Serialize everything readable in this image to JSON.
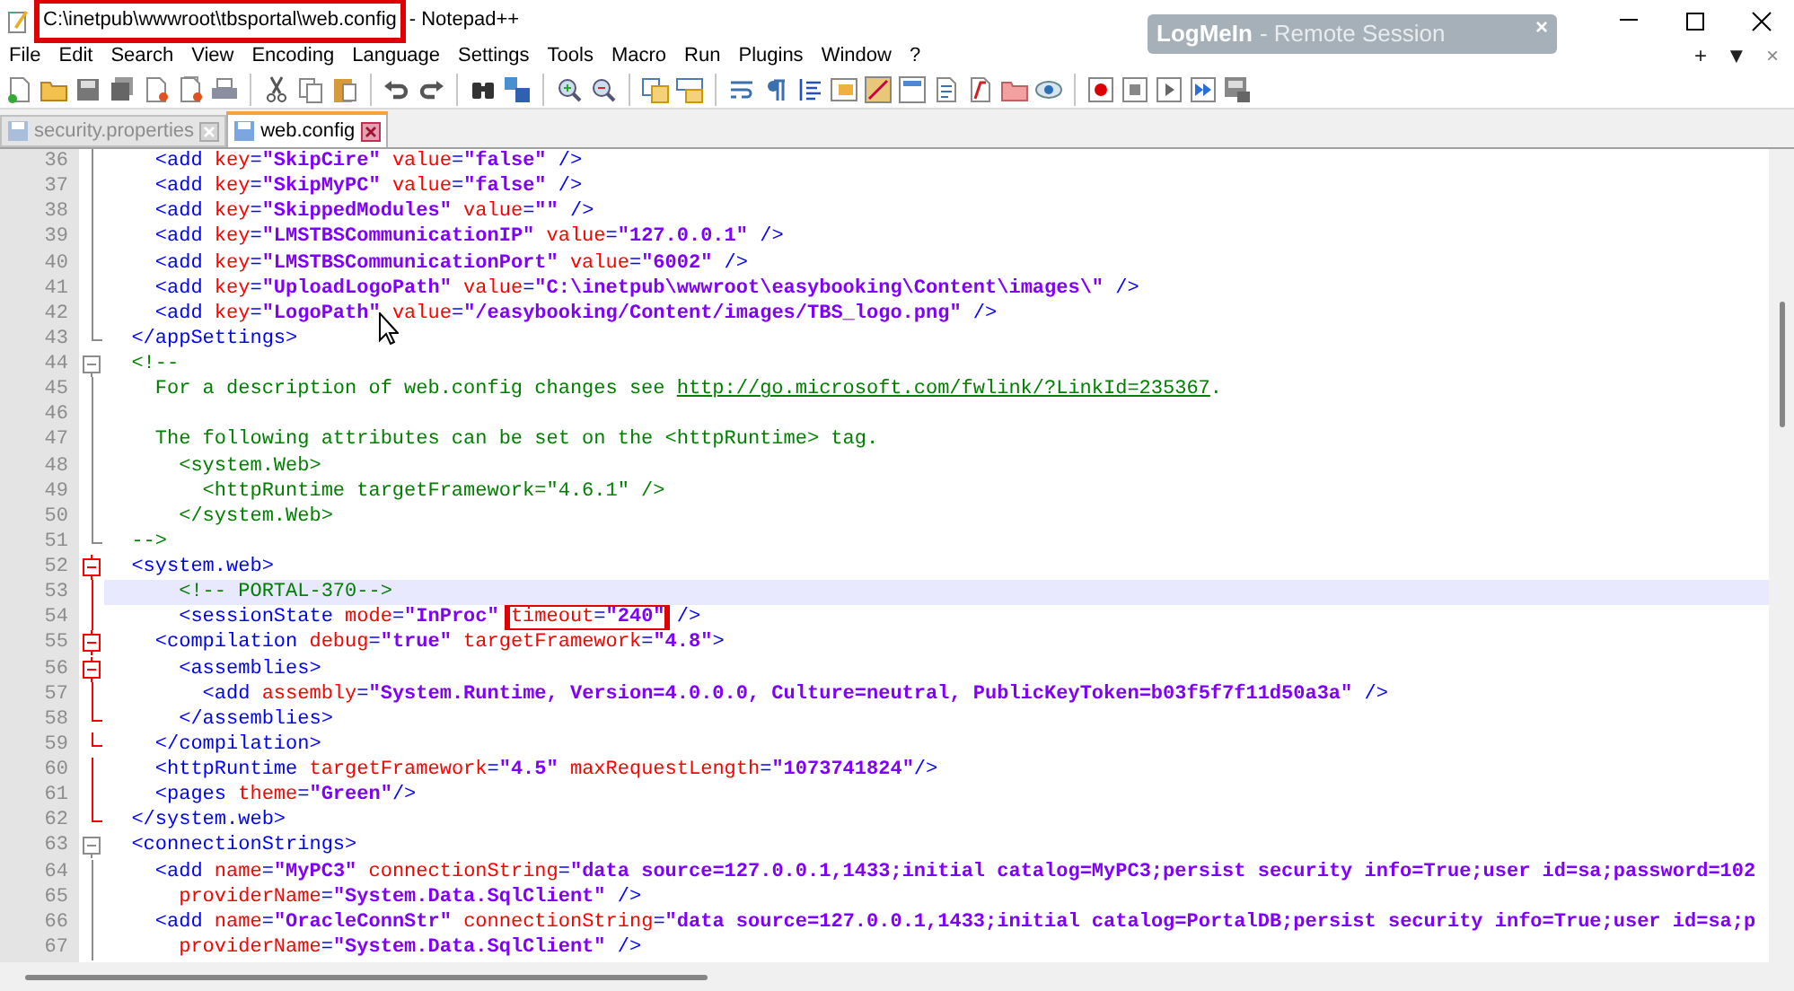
{
  "window": {
    "title_parts": [
      {
        "text": "C:\\inetpub\\wwwroot\\tbsportal\\web.config",
        "highlighted": true
      },
      {
        "text": "- Notepad++",
        "highlighted": false
      }
    ]
  },
  "overlay": {
    "brand": "LogMeIn",
    "title": "- Remote Session",
    "close": "×"
  },
  "menu": [
    "File",
    "Edit",
    "Search",
    "View",
    "Encoding",
    "Language",
    "Settings",
    "Tools",
    "Macro",
    "Run",
    "Plugins",
    "Window",
    "?"
  ],
  "menu_right": [
    "+",
    "▼",
    "×"
  ],
  "tabs": [
    {
      "label": "security.properties",
      "selected": false
    },
    {
      "label": "web.config",
      "selected": true
    }
  ],
  "lines": [
    {
      "number": "36",
      "kind": "fold-line",
      "fold_active": false,
      "current": false,
      "tokens": [
        {
          "kind": "tag",
          "text": "    <add"
        },
        {
          "kind": "attr",
          "text": " key"
        },
        {
          "kind": "tag",
          "text": "="
        },
        {
          "kind": "val",
          "text": "\"SkipCire\""
        },
        {
          "kind": "attr",
          "text": " value"
        },
        {
          "kind": "tag",
          "text": "="
        },
        {
          "kind": "val",
          "text": "\"false\""
        },
        {
          "kind": "tag",
          "text": " />"
        }
      ]
    },
    {
      "number": "37",
      "kind": "fold-line",
      "fold_active": false,
      "current": false,
      "tokens": [
        {
          "kind": "tag",
          "text": "    <add"
        },
        {
          "kind": "attr",
          "text": " key"
        },
        {
          "kind": "tag",
          "text": "="
        },
        {
          "kind": "val",
          "text": "\"SkipMyPC\""
        },
        {
          "kind": "attr",
          "text": " value"
        },
        {
          "kind": "tag",
          "text": "="
        },
        {
          "kind": "val",
          "text": "\"false\""
        },
        {
          "kind": "tag",
          "text": " />"
        }
      ]
    },
    {
      "number": "38",
      "kind": "fold-line",
      "fold_active": false,
      "current": false,
      "tokens": [
        {
          "kind": "tag",
          "text": "    <add"
        },
        {
          "kind": "attr",
          "text": " key"
        },
        {
          "kind": "tag",
          "text": "="
        },
        {
          "kind": "val",
          "text": "\"SkippedModules\""
        },
        {
          "kind": "attr",
          "text": " value"
        },
        {
          "kind": "tag",
          "text": "="
        },
        {
          "kind": "val",
          "text": "\"\""
        },
        {
          "kind": "tag",
          "text": " />"
        }
      ]
    },
    {
      "number": "39",
      "kind": "fold-line",
      "fold_active": false,
      "current": false,
      "tokens": [
        {
          "kind": "tag",
          "text": "    <add"
        },
        {
          "kind": "attr",
          "text": " key"
        },
        {
          "kind": "tag",
          "text": "="
        },
        {
          "kind": "val",
          "text": "\"LMSTBSCommunicationIP\""
        },
        {
          "kind": "attr",
          "text": " value"
        },
        {
          "kind": "tag",
          "text": "="
        },
        {
          "kind": "val",
          "text": "\"127.0.0.1\""
        },
        {
          "kind": "tag",
          "text": " />"
        }
      ]
    },
    {
      "number": "40",
      "kind": "fold-line",
      "fold_active": false,
      "current": false,
      "tokens": [
        {
          "kind": "tag",
          "text": "    <add"
        },
        {
          "kind": "attr",
          "text": " key"
        },
        {
          "kind": "tag",
          "text": "="
        },
        {
          "kind": "val",
          "text": "\"LMSTBSCommunicationPort\""
        },
        {
          "kind": "attr",
          "text": " value"
        },
        {
          "kind": "tag",
          "text": "="
        },
        {
          "kind": "val",
          "text": "\"6002\""
        },
        {
          "kind": "tag",
          "text": " />"
        }
      ]
    },
    {
      "number": "41",
      "kind": "fold-line",
      "fold_active": false,
      "current": false,
      "tokens": [
        {
          "kind": "tag",
          "text": "    <add"
        },
        {
          "kind": "attr",
          "text": " key"
        },
        {
          "kind": "tag",
          "text": "="
        },
        {
          "kind": "val",
          "text": "\"UploadLogoPath\""
        },
        {
          "kind": "attr",
          "text": " value"
        },
        {
          "kind": "tag",
          "text": "="
        },
        {
          "kind": "val",
          "text": "\"C:\\inetpub\\wwwroot\\easybooking\\Content\\images\\\""
        },
        {
          "kind": "tag",
          "text": " />"
        }
      ]
    },
    {
      "number": "42",
      "kind": "fold-line",
      "fold_active": false,
      "current": false,
      "tokens": [
        {
          "kind": "tag",
          "text": "    <add"
        },
        {
          "kind": "attr",
          "text": " key"
        },
        {
          "kind": "tag",
          "text": "="
        },
        {
          "kind": "val",
          "text": "\"LogoPath\""
        },
        {
          "kind": "attr",
          "text": " value"
        },
        {
          "kind": "tag",
          "text": "="
        },
        {
          "kind": "val",
          "text": "\"/easybooking/Content/images/TBS_logo.png\""
        },
        {
          "kind": "tag",
          "text": " />"
        }
      ]
    },
    {
      "number": "43",
      "kind": "fold-end",
      "fold_active": false,
      "current": false,
      "tokens": [
        {
          "kind": "tag",
          "text": "  </appSettings>"
        }
      ]
    },
    {
      "number": "44",
      "kind": "fold-open",
      "fold_active": false,
      "current": false,
      "tokens": [
        {
          "kind": "comment",
          "text": "  <!--"
        }
      ]
    },
    {
      "number": "45",
      "kind": "fold-line",
      "fold_active": false,
      "current": false,
      "tokens": [
        {
          "kind": "comment",
          "text": "    For a description of web.config changes see "
        },
        {
          "kind": "link",
          "text": "http://go.microsoft.com/fwlink/?LinkId=235367"
        },
        {
          "kind": "comment",
          "text": "."
        }
      ]
    },
    {
      "number": "46",
      "kind": "fold-line",
      "fold_active": false,
      "current": false
    },
    {
      "number": "47",
      "kind": "fold-line",
      "fold_active": false,
      "current": false,
      "tokens": [
        {
          "kind": "comment",
          "text": "    The following attributes can be set on the <httpRuntime> tag."
        }
      ]
    },
    {
      "number": "48",
      "kind": "fold-line",
      "fold_active": false,
      "current": false,
      "tokens": [
        {
          "kind": "comment",
          "text": "      <system.Web>"
        }
      ]
    },
    {
      "number": "49",
      "kind": "fold-line",
      "fold_active": false,
      "current": false,
      "tokens": [
        {
          "kind": "comment",
          "text": "        <httpRuntime targetFramework=\"4.6.1\" />"
        }
      ]
    },
    {
      "number": "50",
      "kind": "fold-line",
      "fold_active": false,
      "current": false,
      "tokens": [
        {
          "kind": "comment",
          "text": "      </system.Web>"
        }
      ]
    },
    {
      "number": "51",
      "kind": "fold-end",
      "fold_active": false,
      "current": false,
      "tokens": [
        {
          "kind": "comment",
          "text": "  -->"
        }
      ]
    },
    {
      "number": "52",
      "kind": "fold-open",
      "fold_active": true,
      "current": false,
      "tokens": [
        {
          "kind": "tag",
          "text": "  <system.web>"
        }
      ]
    },
    {
      "number": "53",
      "kind": "fold-line",
      "fold_active": true,
      "current": true,
      "tokens": [
        {
          "kind": "comment",
          "text": "      <!-- PORTAL-370-->"
        }
      ]
    },
    {
      "number": "54",
      "kind": "fold-line",
      "fold_active": true,
      "current": false,
      "tokens": [
        {
          "kind": "tag",
          "text": "      <sessionState"
        },
        {
          "kind": "attr",
          "text": " mode"
        },
        {
          "kind": "tag",
          "text": "="
        },
        {
          "kind": "val",
          "text": "\"InProc\""
        },
        {
          "kind": "group",
          "highlighted": true,
          "parts": [
            {
              "kind": "attr",
              "text": "timeout"
            },
            {
              "kind": "tag",
              "text": "="
            },
            {
              "kind": "val",
              "text": "\"240\""
            }
          ]
        },
        {
          "kind": "tag",
          "text": " />"
        }
      ]
    },
    {
      "number": "55",
      "kind": "fold-open",
      "fold_active": true,
      "current": false,
      "tokens": [
        {
          "kind": "tag",
          "text": "    <compilation"
        },
        {
          "kind": "attr",
          "text": " debug"
        },
        {
          "kind": "tag",
          "text": "="
        },
        {
          "kind": "val",
          "text": "\"true\""
        },
        {
          "kind": "attr",
          "text": " targetFramework"
        },
        {
          "kind": "tag",
          "text": "="
        },
        {
          "kind": "val",
          "text": "\"4.8\""
        },
        {
          "kind": "tag",
          "text": ">"
        }
      ]
    },
    {
      "number": "56",
      "kind": "fold-open",
      "fold_active": true,
      "current": false,
      "tokens": [
        {
          "kind": "tag",
          "text": "      <assemblies>"
        }
      ]
    },
    {
      "number": "57",
      "kind": "fold-line",
      "fold_active": true,
      "current": false,
      "tokens": [
        {
          "kind": "tag",
          "text": "        <add"
        },
        {
          "kind": "attr",
          "text": " assembly"
        },
        {
          "kind": "tag",
          "text": "="
        },
        {
          "kind": "val",
          "text": "\"System.Runtime, Version=4.0.0.0, Culture=neutral, PublicKeyToken=b03f5f7f11d50a3a\""
        },
        {
          "kind": "tag",
          "text": " />"
        }
      ]
    },
    {
      "number": "58",
      "kind": "fold-end",
      "fold_active": true,
      "current": false,
      "tokens": [
        {
          "kind": "tag",
          "text": "      </assemblies>"
        }
      ]
    },
    {
      "number": "59",
      "kind": "fold-end",
      "fold_active": true,
      "current": false,
      "tokens": [
        {
          "kind": "tag",
          "text": "    </compilation>"
        }
      ]
    },
    {
      "number": "60",
      "kind": "fold-line",
      "fold_active": true,
      "current": false,
      "tokens": [
        {
          "kind": "tag",
          "text": "    <httpRuntime"
        },
        {
          "kind": "attr",
          "text": " targetFramework"
        },
        {
          "kind": "tag",
          "text": "="
        },
        {
          "kind": "val",
          "text": "\"4.5\""
        },
        {
          "kind": "attr",
          "text": " maxRequestLength"
        },
        {
          "kind": "tag",
          "text": "="
        },
        {
          "kind": "val",
          "text": "\"1073741824\""
        },
        {
          "kind": "tag",
          "text": "/>"
        }
      ]
    },
    {
      "number": "61",
      "kind": "fold-line",
      "fold_active": true,
      "current": false,
      "tokens": [
        {
          "kind": "tag",
          "text": "    <pages"
        },
        {
          "kind": "attr",
          "text": " theme"
        },
        {
          "kind": "tag",
          "text": "="
        },
        {
          "kind": "val",
          "text": "\"Green\""
        },
        {
          "kind": "tag",
          "text": "/>"
        }
      ]
    },
    {
      "number": "62",
      "kind": "fold-end",
      "fold_active": true,
      "current": false,
      "tokens": [
        {
          "kind": "tag",
          "text": "  </system.web>"
        }
      ]
    },
    {
      "number": "63",
      "kind": "fold-open",
      "fold_active": false,
      "current": false,
      "tokens": [
        {
          "kind": "tag",
          "text": "  <connectionStrings>"
        }
      ]
    },
    {
      "number": "64",
      "kind": "fold-line",
      "fold_active": false,
      "current": false,
      "tokens": [
        {
          "kind": "tag",
          "text": "    <add"
        },
        {
          "kind": "attr",
          "text": " name"
        },
        {
          "kind": "tag",
          "text": "="
        },
        {
          "kind": "val",
          "text": "\"MyPC3\""
        },
        {
          "kind": "attr",
          "text": " connectionString"
        },
        {
          "kind": "tag",
          "text": "="
        },
        {
          "kind": "val",
          "text": "\"data source=127.0.0.1,1433;initial catalog=MyPC3;persist security info=True;user id=sa;password=102"
        }
      ]
    },
    {
      "number": "65",
      "kind": "fold-line",
      "fold_active": false,
      "current": false,
      "tokens": [
        {
          "kind": "attr",
          "text": "      providerName"
        },
        {
          "kind": "tag",
          "text": "="
        },
        {
          "kind": "val",
          "text": "\"System.Data.SqlClient\""
        },
        {
          "kind": "tag",
          "text": " />"
        }
      ]
    },
    {
      "number": "66",
      "kind": "fold-line",
      "fold_active": false,
      "current": false,
      "tokens": [
        {
          "kind": "tag",
          "text": "    <add"
        },
        {
          "kind": "attr",
          "text": " name"
        },
        {
          "kind": "tag",
          "text": "="
        },
        {
          "kind": "val",
          "text": "\"OracleConnStr\""
        },
        {
          "kind": "attr",
          "text": " connectionString"
        },
        {
          "kind": "tag",
          "text": "="
        },
        {
          "kind": "val",
          "text": "\"data source=127.0.0.1,1433;initial catalog=PortalDB;persist security info=True;user id=sa;p"
        }
      ]
    },
    {
      "number": "67",
      "kind": "fold-line",
      "fold_active": false,
      "current": false,
      "tokens": [
        {
          "kind": "attr",
          "text": "      providerName"
        },
        {
          "kind": "tag",
          "text": "="
        },
        {
          "kind": "val",
          "text": "\"System.Data.SqlClient\""
        },
        {
          "kind": "tag",
          "text": " />"
        }
      ]
    }
  ]
}
